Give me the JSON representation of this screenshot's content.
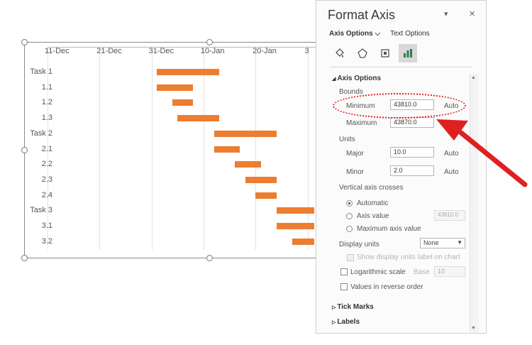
{
  "chart": {
    "x_ticks": [
      "11-Dec",
      "21-Dec",
      "31-Dec",
      "10-Jan",
      "20-Jan",
      "3"
    ],
    "tasks": [
      "Task 1",
      "1.1",
      "1.2",
      "1.3",
      "Task 2",
      "2.1",
      "2.2",
      "2.3",
      "2.4",
      "Task 3",
      "3.1",
      "3.2"
    ],
    "bar_color": "#ed7d31"
  },
  "chart_data": {
    "type": "bar",
    "orientation": "horizontal-gantt",
    "x_axis_min": "11-Dec",
    "categories": [
      "Task 1",
      "1.1",
      "1.2",
      "1.3",
      "Task 2",
      "2.1",
      "2.2",
      "2.3",
      "2.4",
      "Task 3",
      "3.1",
      "3.2"
    ],
    "bars": [
      {
        "label": "Task 1",
        "start": "Jan 1",
        "end": "Jan 13"
      },
      {
        "label": "1.1",
        "start": "Jan 1",
        "end": "Jan 8"
      },
      {
        "label": "1.2",
        "start": "Jan 4",
        "end": "Jan 8"
      },
      {
        "label": "1.3",
        "start": "Jan 5",
        "end": "Jan 13"
      },
      {
        "label": "Task 2",
        "start": "Jan 12",
        "end": "Jan 24"
      },
      {
        "label": "2.1",
        "start": "Jan 12",
        "end": "Jan 17"
      },
      {
        "label": "2.2",
        "start": "Jan 16",
        "end": "Jan 21"
      },
      {
        "label": "2.3",
        "start": "Jan 18",
        "end": "Jan 24"
      },
      {
        "label": "2.4",
        "start": "Jan 20",
        "end": "Jan 24"
      },
      {
        "label": "Task 3",
        "start": "Jan 24",
        "end": "Feb 1"
      },
      {
        "label": "3.1",
        "start": "Jan 24",
        "end": "Feb 1"
      },
      {
        "label": "3.2",
        "start": "Jan 27",
        "end": "Feb 1"
      }
    ]
  },
  "panel": {
    "title": "Format Axis",
    "dropdown_glyph": "▾",
    "close_glyph": "✕",
    "tab_axis_options": "Axis Options ⌵",
    "tab_text_options": "Text Options",
    "section_axis_options": "Axis Options",
    "bounds_label": "Bounds",
    "minimum_label": "Minimum",
    "minimum_value": "43810.0",
    "minimum_state": "Auto",
    "maximum_label": "Maximum",
    "maximum_value": "43870.0",
    "units_label": "Units",
    "major_label": "Major",
    "major_value": "10.0",
    "major_state": "Auto",
    "minor_label": "Minor",
    "minor_value": "2.0",
    "minor_state": "Auto",
    "vertical_axis_crosses": "Vertical axis crosses",
    "automatic": "Automatic",
    "axis_value": "Axis value",
    "axis_value_input": "43810.0",
    "maximum_axis_value": "Maximum axis value",
    "display_units_label": "Display units",
    "display_units_value": "None",
    "show_units_label": "Show display units label on chart",
    "log_scale": "Logarithmic scale",
    "base_label": "Base",
    "base_value": "10",
    "reverse_order": "Values in reverse order",
    "tick_marks": "Tick Marks",
    "labels": "Labels"
  },
  "annotation": {
    "color": "#e02020"
  }
}
